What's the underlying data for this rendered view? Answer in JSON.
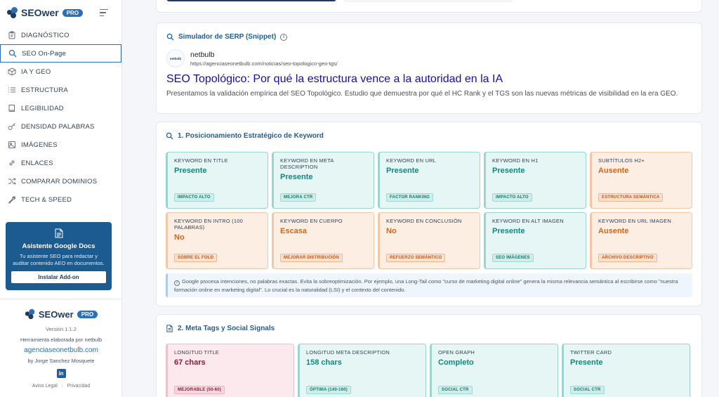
{
  "sidebar": {
    "brand": "SEOwer",
    "pro": "PRO",
    "items": [
      {
        "label": "DIAGNÓSTICO",
        "icon": "clipboard-icon"
      },
      {
        "label": "SEO On-Page",
        "icon": "search-icon"
      },
      {
        "label": "IA Y GEO",
        "icon": "cube-icon"
      },
      {
        "label": "ESTRUCTURA",
        "icon": "list-icon"
      },
      {
        "label": "LEGIBILIDAD",
        "icon": "book-icon"
      },
      {
        "label": "DENSIDAD PALABRAS",
        "icon": "key-icon"
      },
      {
        "label": "IMÁGENES",
        "icon": "image-icon"
      },
      {
        "label": "ENLACES",
        "icon": "link-icon"
      },
      {
        "label": "COMPARAR DOMINIOS",
        "icon": "shuffle-icon"
      },
      {
        "label": "TECH & SPEED",
        "icon": "wrench-icon"
      }
    ],
    "promo": {
      "title": "Asistente Google Docs",
      "desc": "Tu asistente SEO para redactar y auditar contenido AEO en documentos.",
      "button": "Instalar Add-on"
    },
    "footer": {
      "brand": "SEOwer",
      "pro": "PRO",
      "version": "Versión 1.1.2",
      "made_by": "Herramienta elaborada por netbulb",
      "site": "agenciaseonetbulb.com",
      "author": "by Jorge Sanchez Mosquete",
      "linkedin": "in",
      "legal": "Aviso Legal",
      "privacy": "Privacidad"
    }
  },
  "serp": {
    "title": "Simulador de SERP (Snippet)",
    "info": "i",
    "favicon_text": "netbulb",
    "site_name": "netbulb",
    "url": "https://agenciaseonetbulb.com/noticias/seo-topologico-geo-tgs/",
    "headline": "SEO Topológico: Por qué la estructura vence a la autoridad en la IA",
    "description": "Presentamos la validación empírica del SEO Topológico. Estudio que demuestra por qué el HC Rank y el TGS son las nuevas métricas de visibilidad en la era GEO."
  },
  "keyword": {
    "title": "1. Posicionamiento Estratégico de Keyword",
    "tiles": [
      {
        "label": "KEYWORD EN TITLE",
        "value": "Presente",
        "tag": "IMPACTO ALTO",
        "status": "ok"
      },
      {
        "label": "KEYWORD EN META DESCRIPTION",
        "value": "Presente",
        "tag": "MEJORA CTR",
        "status": "ok"
      },
      {
        "label": "KEYWORD EN URL",
        "value": "Presente",
        "tag": "FACTOR RANKING",
        "status": "ok"
      },
      {
        "label": "KEYWORD EN H1",
        "value": "Presente",
        "tag": "IMPACTO ALTO",
        "status": "ok"
      },
      {
        "label": "SUBTÍTULOS H2+",
        "value": "Ausente",
        "tag": "ESTRUCTURA SEMÁNTICA",
        "status": "bad"
      },
      {
        "label": "KEYWORD EN INTRO (100 PALABRAS)",
        "value": "No",
        "tag": "SOBRE EL FOLD",
        "status": "bad"
      },
      {
        "label": "KEYWORD EN CUERPO",
        "value": "Escasa",
        "tag": "MEJORAR DISTRIBUCIÓN",
        "status": "bad"
      },
      {
        "label": "KEYWORD EN CONCLUSIÓN",
        "value": "No",
        "tag": "REFUERZO SEMÁNTICO",
        "status": "bad"
      },
      {
        "label": "KEYWORD EN ALT IMAGEN",
        "value": "Presente",
        "tag": "SEO IMÁGENES",
        "status": "ok"
      },
      {
        "label": "KEYWORD EN URL IMAGEN",
        "value": "Ausente",
        "tag": "ARCHIVO DESCRIPTIVO",
        "status": "bad"
      }
    ],
    "note": "Google procesa intenciones, no palabras exactas. Evita la sobreoptimización. Por ejemplo, una Long-Tail como \"curso de marketing digital online\" genera la misma relevancia semántica al escribirse como \"nuestra formación online en marketing digital\". Lo crucial es la naturalidad (LSI) y el contexto del contenido."
  },
  "meta": {
    "title": "2. Meta Tags y Social Signals",
    "tiles": [
      {
        "label": "LONGITUD TITLE",
        "value": "67 chars",
        "tag": "MEJORABLE (50-60)",
        "status": "red"
      },
      {
        "label": "LONGITUD META DESCRIPTION",
        "value": "158 chars",
        "tag": "ÓPTIMA (140-160)",
        "status": "ok"
      },
      {
        "label": "OPEN GRAPH",
        "value": "Completo",
        "tag": "SOCIAL CTR",
        "status": "ok"
      },
      {
        "label": "TWITTER CARD",
        "value": "Presente",
        "tag": "SOCIAL CTR",
        "status": "ok"
      }
    ]
  }
}
